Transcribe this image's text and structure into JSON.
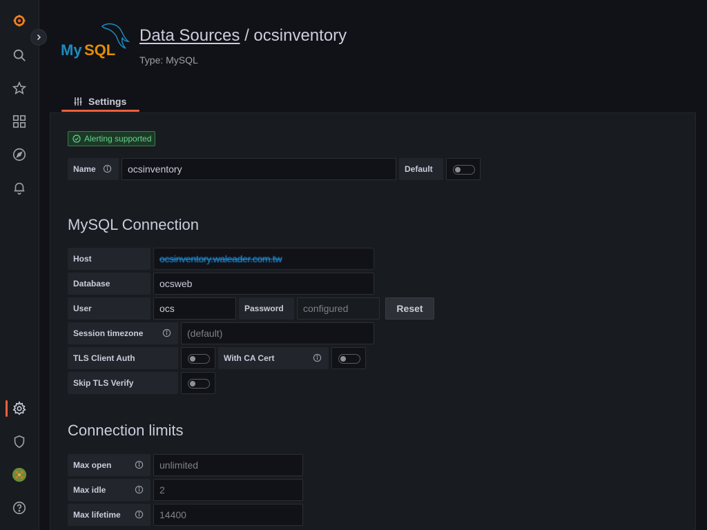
{
  "header": {
    "breadcrumb_link": "Data Sources",
    "separator": " / ",
    "name": "ocsinventory",
    "type_line": "Type: MySQL",
    "logo_text": "MySQL"
  },
  "tabs": [
    {
      "label": "Settings",
      "icon": "sliders-icon",
      "active": true
    }
  ],
  "badge": {
    "label": "Alerting supported",
    "icon": "check-circle-icon"
  },
  "name_row": {
    "label": "Name",
    "value": "ocsinventory",
    "default_label": "Default",
    "default_on": false
  },
  "mysql_connection": {
    "title": "MySQL Connection",
    "host_label": "Host",
    "host_value": "ocsinventory.waleader.com.tw",
    "database_label": "Database",
    "database_value": "ocsweb",
    "user_label": "User",
    "user_value": "ocs",
    "password_label": "Password",
    "password_value": "configured",
    "reset_label": "Reset",
    "timezone_label": "Session timezone",
    "timezone_value": "(default)",
    "tls_client_auth_label": "TLS Client Auth",
    "tls_client_auth_on": false,
    "with_ca_cert_label": "With CA Cert",
    "with_ca_cert_on": false,
    "skip_tls_label": "Skip TLS Verify",
    "skip_tls_on": false
  },
  "connection_limits": {
    "title": "Connection limits",
    "max_open_label": "Max open",
    "max_open_value": "unlimited",
    "max_idle_label": "Max idle",
    "max_idle_value": "2",
    "max_lifetime_label": "Max lifetime",
    "max_lifetime_value": "14400"
  },
  "sidebar": {
    "items": [
      "grafana-logo-icon",
      "search-icon",
      "star-icon",
      "dashboards-icon",
      "explore-icon",
      "alerting-icon",
      "configuration-icon",
      "shield-icon",
      "avatar",
      "help-icon"
    ],
    "active": "configuration-icon"
  },
  "colors": {
    "accent": "#f55f3e",
    "badge": "#6ccf8e",
    "background": "#111217",
    "panel": "#181b1f"
  }
}
